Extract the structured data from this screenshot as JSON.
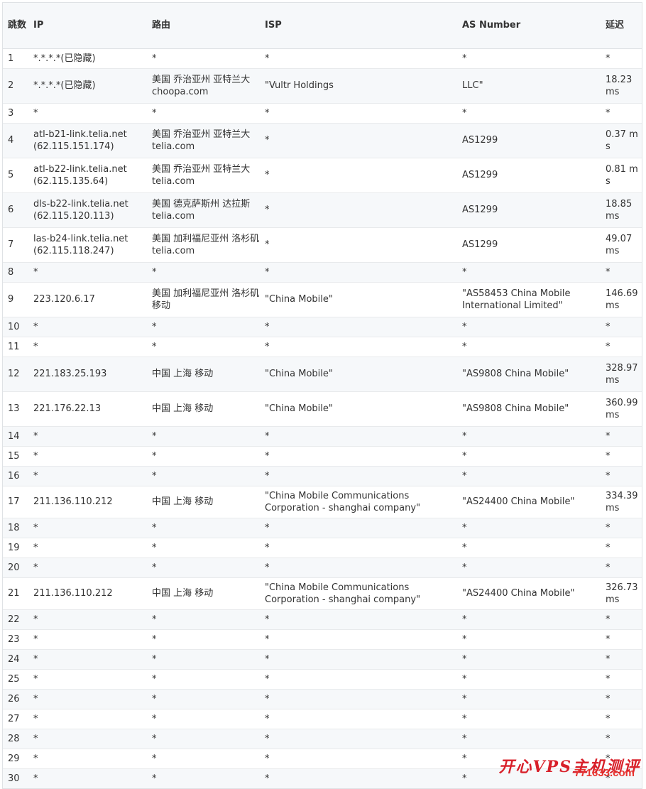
{
  "table": {
    "headers": {
      "hop": "跳数",
      "ip": "IP",
      "route": "路由",
      "isp": "ISP",
      "as": "AS Number",
      "latency": "延迟"
    },
    "rows": [
      {
        "hop": "1",
        "ip": "*.*.*.*(已隐藏)",
        "route": "*",
        "isp": "*",
        "as": "*",
        "latency": "*"
      },
      {
        "hop": "2",
        "ip": "*.*.*.*(已隐藏)",
        "route": "美国 乔治亚州 亚特兰大 choopa.com",
        "isp": "\"Vultr Holdings",
        "as": "LLC\"",
        "latency": "18.23 ms"
      },
      {
        "hop": "3",
        "ip": "*",
        "route": "*",
        "isp": "*",
        "as": "*",
        "latency": "*"
      },
      {
        "hop": "4",
        "ip": "atl-b21-link.telia.net (62.115.151.174)",
        "route": "美国 乔治亚州 亚特兰大 telia.com",
        "isp": "*",
        "as": "AS1299",
        "latency": "0.37 ms"
      },
      {
        "hop": "5",
        "ip": "atl-b22-link.telia.net (62.115.135.64)",
        "route": "美国 乔治亚州 亚特兰大 telia.com",
        "isp": "*",
        "as": "AS1299",
        "latency": "0.81 ms"
      },
      {
        "hop": "6",
        "ip": "dls-b22-link.telia.net (62.115.120.113)",
        "route": "美国 德克萨斯州 达拉斯 telia.com",
        "isp": "*",
        "as": "AS1299",
        "latency": "18.85 ms"
      },
      {
        "hop": "7",
        "ip": "las-b24-link.telia.net (62.115.118.247)",
        "route": "美国 加利福尼亚州 洛杉矶 telia.com",
        "isp": "*",
        "as": "AS1299",
        "latency": "49.07 ms"
      },
      {
        "hop": "8",
        "ip": "*",
        "route": "*",
        "isp": "*",
        "as": "*",
        "latency": "*"
      },
      {
        "hop": "9",
        "ip": "223.120.6.17",
        "route": "美国 加利福尼亚州 洛杉矶 移动",
        "isp": "\"China Mobile\"",
        "as": "\"AS58453 China Mobile International Limited\"",
        "latency": "146.69 ms"
      },
      {
        "hop": "10",
        "ip": "*",
        "route": "*",
        "isp": "*",
        "as": "*",
        "latency": "*"
      },
      {
        "hop": "11",
        "ip": "*",
        "route": "*",
        "isp": "*",
        "as": "*",
        "latency": "*"
      },
      {
        "hop": "12",
        "ip": "221.183.25.193",
        "route": "中国 上海 移动",
        "isp": "\"China Mobile\"",
        "as": "\"AS9808 China Mobile\"",
        "latency": "328.97 ms"
      },
      {
        "hop": "13",
        "ip": "221.176.22.13",
        "route": "中国 上海 移动",
        "isp": "\"China Mobile\"",
        "as": "\"AS9808 China Mobile\"",
        "latency": "360.99 ms"
      },
      {
        "hop": "14",
        "ip": "*",
        "route": "*",
        "isp": "*",
        "as": "*",
        "latency": "*"
      },
      {
        "hop": "15",
        "ip": "*",
        "route": "*",
        "isp": "*",
        "as": "*",
        "latency": "*"
      },
      {
        "hop": "16",
        "ip": "*",
        "route": "*",
        "isp": "*",
        "as": "*",
        "latency": "*"
      },
      {
        "hop": "17",
        "ip": "211.136.110.212",
        "route": "中国 上海 移动",
        "isp": "\"China Mobile Communications Corporation - shanghai company\"",
        "as": "\"AS24400 China Mobile\"",
        "latency": "334.39 ms"
      },
      {
        "hop": "18",
        "ip": "*",
        "route": "*",
        "isp": "*",
        "as": "*",
        "latency": "*"
      },
      {
        "hop": "19",
        "ip": "*",
        "route": "*",
        "isp": "*",
        "as": "*",
        "latency": "*"
      },
      {
        "hop": "20",
        "ip": "*",
        "route": "*",
        "isp": "*",
        "as": "*",
        "latency": "*"
      },
      {
        "hop": "21",
        "ip": "211.136.110.212",
        "route": "中国 上海 移动",
        "isp": "\"China Mobile Communications Corporation - shanghai company\"",
        "as": "\"AS24400 China Mobile\"",
        "latency": "326.73 ms"
      },
      {
        "hop": "22",
        "ip": "*",
        "route": "*",
        "isp": "*",
        "as": "*",
        "latency": "*"
      },
      {
        "hop": "23",
        "ip": "*",
        "route": "*",
        "isp": "*",
        "as": "*",
        "latency": "*"
      },
      {
        "hop": "24",
        "ip": "*",
        "route": "*",
        "isp": "*",
        "as": "*",
        "latency": "*"
      },
      {
        "hop": "25",
        "ip": "*",
        "route": "*",
        "isp": "*",
        "as": "*",
        "latency": "*"
      },
      {
        "hop": "26",
        "ip": "*",
        "route": "*",
        "isp": "*",
        "as": "*",
        "latency": "*"
      },
      {
        "hop": "27",
        "ip": "*",
        "route": "*",
        "isp": "*",
        "as": "*",
        "latency": "*"
      },
      {
        "hop": "28",
        "ip": "*",
        "route": "*",
        "isp": "*",
        "as": "*",
        "latency": "*"
      },
      {
        "hop": "29",
        "ip": "*",
        "route": "*",
        "isp": "*",
        "as": "*",
        "latency": "*"
      },
      {
        "hop": "30",
        "ip": "*",
        "route": "*",
        "isp": "*",
        "as": "*",
        "latency": "*"
      }
    ]
  },
  "watermark": {
    "text": "开心VPS主机测评",
    "url": "771633.com",
    "color": "#d8202a"
  }
}
